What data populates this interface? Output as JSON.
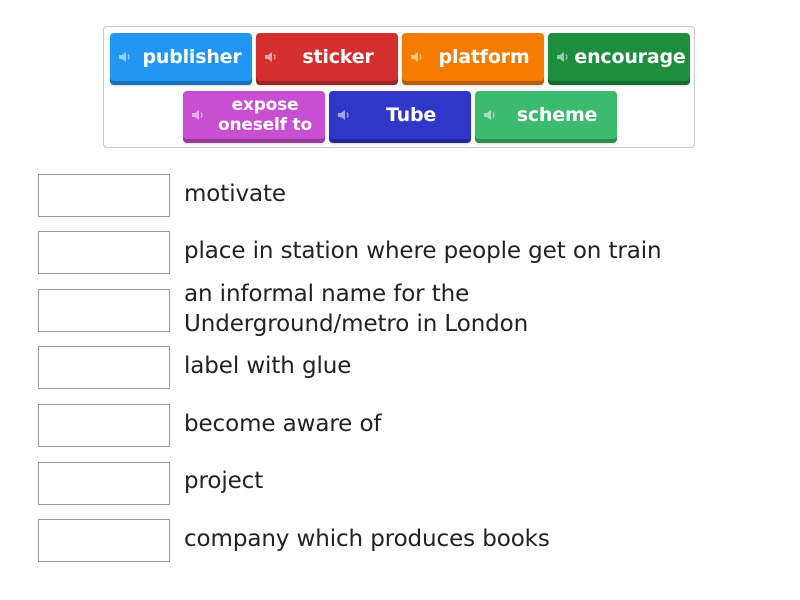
{
  "word_bank": {
    "tiles": [
      {
        "label": "publisher",
        "color": "#2196f3"
      },
      {
        "label": "sticker",
        "color": "#d32f2f"
      },
      {
        "label": "platform",
        "color": "#f57c00"
      },
      {
        "label": "encourage",
        "color": "#1e8e3e"
      },
      {
        "label": "expose oneself to",
        "color": "#c94fd2"
      },
      {
        "label": "Tube",
        "color": "#2f36c8"
      },
      {
        "label": "scheme",
        "color": "#3cba6e"
      }
    ],
    "tile_icon": "speaker-icon"
  },
  "matches": [
    {
      "definition": "motivate",
      "answer": ""
    },
    {
      "definition": "place in station where people get on train",
      "answer": ""
    },
    {
      "definition": "an informal name for the Underground/metro in London",
      "answer": ""
    },
    {
      "definition": "label with glue",
      "answer": ""
    },
    {
      "definition": "become aware of",
      "answer": ""
    },
    {
      "definition": "project",
      "answer": ""
    },
    {
      "definition": "company which produces books",
      "answer": ""
    }
  ]
}
